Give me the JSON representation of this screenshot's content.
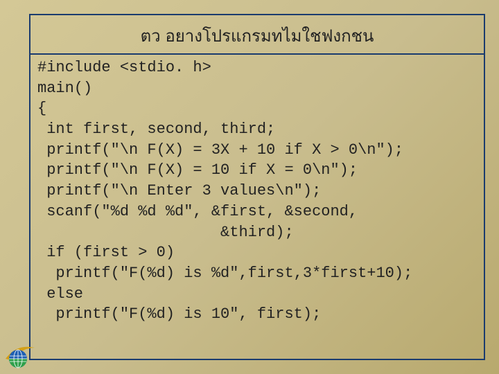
{
  "title": "ตว อยางโปรแกรมทไมใชฟงกชน",
  "code": {
    "l1": "#include <stdio. h>",
    "l2": "main()",
    "l3": "{",
    "l4": " int first, second, third;",
    "l5": " printf(\"\\n F(X) = 3X + 10 if X > 0\\n\");",
    "l6": " printf(\"\\n F(X) = 10 if X = 0\\n\");",
    "l7": " printf(\"\\n Enter 3 values\\n\");",
    "l8": " scanf(\"%d %d %d\", &first, &second,",
    "l9": "                    &third);",
    "l10": " if (first > 0)",
    "l11": "  printf(\"F(%d) is %d\",first,3*first+10);",
    "l12": " else",
    "l13": "  printf(\"F(%d) is 10\", first);"
  },
  "logo": {
    "name": "globe-swoosh-logo",
    "colors": {
      "swoosh": "#d4a017",
      "globe_top": "#1e5fb3",
      "globe_bottom": "#2fa04a"
    }
  }
}
